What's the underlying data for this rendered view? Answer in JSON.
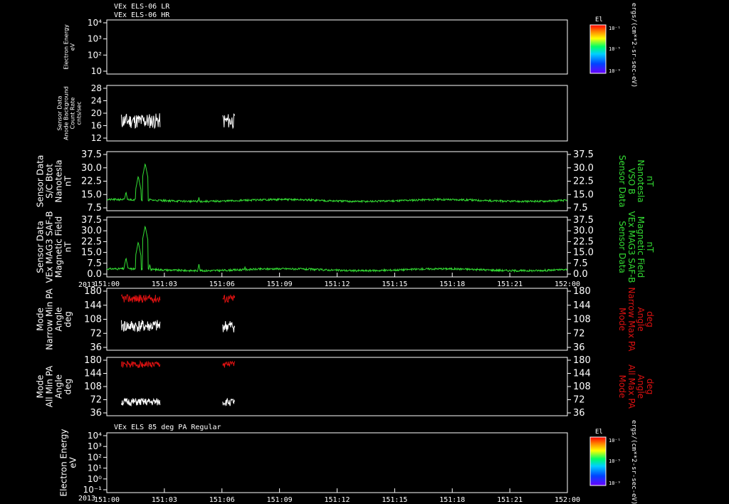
{
  "colors": {
    "background": "#000000",
    "axis": "#ffffff",
    "white_trace": "#ffffff",
    "green_trace": "#33dd33",
    "red_trace": "#dd1111"
  },
  "top_headers": {
    "line1": "VEx ELS-06 LR",
    "line2": "VEx ELS-06 HR"
  },
  "bottom_header": "VEx ELS 85 deg PA Regular",
  "x_axis": {
    "year": "2013",
    "ticks": [
      "151:00",
      "151:03",
      "151:06",
      "151:09",
      "151:12",
      "151:15",
      "151:18",
      "151:21",
      "152:00"
    ]
  },
  "colorbars": [
    {
      "title": "El",
      "ticks": [
        "10⁻¹",
        "10⁻⁵",
        "10⁻⁹"
      ],
      "unit": "ergs/(cm**2-sr-sec-eV)"
    },
    {
      "title": "El",
      "ticks": [
        "10⁻¹",
        "10⁻⁵",
        "10⁻⁹"
      ],
      "unit": "ergs/(cm**2-sr-sec-eV)"
    }
  ],
  "panels": [
    {
      "type": "heatmap",
      "ylabel": [
        "Electron Energy",
        "eV"
      ],
      "yticks": [
        "10⁴",
        "10³",
        "10²",
        "10"
      ]
    },
    {
      "type": "line",
      "ylabel": [
        "Sensor Data",
        "Anode Background",
        "Count Rate",
        "cnts/sec"
      ],
      "yticks": [
        "28",
        "24",
        "20",
        "16",
        "12"
      ]
    },
    {
      "type": "line",
      "ylabel": [
        "Sensor Data",
        "S/C Btot",
        "Nanotesla",
        "nT"
      ],
      "yticks": [
        "37.5",
        "30.0",
        "22.5",
        "15.0",
        "7.5"
      ],
      "right_ylabel": [
        "Sensor Data",
        "VSO B",
        "Nanotesla",
        "nT"
      ],
      "right_yticks": [
        "37.5",
        "30.0",
        "22.5",
        "15.0",
        "7.5"
      ]
    },
    {
      "type": "line",
      "ylabel": [
        "Sensor Data",
        "VEx MAG3 SAF-B",
        "Magnetic Field",
        "nT"
      ],
      "yticks": [
        "37.5",
        "30.0",
        "22.5",
        "15.0",
        "7.5",
        "0.0"
      ],
      "right_ylabel": [
        "Sensor Data",
        "VEx MAG3 SAF-B",
        "Magnetic Field",
        "nT"
      ],
      "right_yticks": [
        "37.5",
        "30.0",
        "22.5",
        "15.0",
        "7.5",
        "0.0"
      ]
    },
    {
      "type": "line",
      "ylabel": [
        "Mode",
        "Narrow Min PA",
        "Angle",
        "deg"
      ],
      "yticks": [
        "180",
        "144",
        "108",
        "72",
        "36"
      ],
      "right_ylabel": [
        "Mode",
        "Narrow Max PA",
        "Angle",
        "deg"
      ],
      "right_yticks": [
        "180",
        "144",
        "108",
        "72",
        "36"
      ]
    },
    {
      "type": "line",
      "ylabel": [
        "Mode",
        "All Min PA",
        "Angle",
        "deg"
      ],
      "yticks": [
        "180",
        "144",
        "108",
        "72",
        "36"
      ],
      "right_ylabel": [
        "Mode",
        "All Max PA",
        "Angle",
        "deg"
      ],
      "right_yticks": [
        "180",
        "144",
        "108",
        "72",
        "36"
      ]
    },
    {
      "type": "heatmap",
      "ylabel": [
        "Electron Energy",
        "eV"
      ],
      "yticks": [
        "10⁴",
        "10³",
        "10²",
        "10¹",
        "10⁰",
        "10⁻¹"
      ]
    }
  ],
  "chart_data": [
    {
      "type": "heatmap",
      "x_minutes_after_151:00": [],
      "data_intervals": [
        [
          151.9,
          153.15
        ],
        [
          153.6,
          156.95
        ],
        [
          165.1,
          166.7
        ]
      ],
      "ylim": [
        1,
        10000
      ],
      "yscale": "log"
    },
    {
      "type": "line",
      "series": [
        {
          "seed": 11,
          "x": [
            [
              151.9,
              156.95
            ],
            [
              165.1,
              166.7
            ]
          ],
          "base": 16.5,
          "amp": 2.5,
          "ylim": [
            10,
            28
          ]
        }
      ]
    },
    {
      "type": "line",
      "series": [
        {
          "seed": 21,
          "xrange": [
            150,
            152
          ],
          "base": 6.5,
          "features": [
            [
              152.5,
              12
            ],
            [
              153.3,
              4
            ],
            [
              154.1,
              22
            ],
            [
              155,
              30
            ],
            [
              155.6,
              8
            ],
            [
              162,
              8.5
            ],
            [
              168,
              7
            ]
          ],
          "ylim": [
            0,
            37.5
          ]
        }
      ]
    },
    {
      "type": "line",
      "series": [
        {
          "seed": 31,
          "xrange": [
            150,
            152
          ],
          "base": 4.5,
          "features": [
            [
              152.5,
              12
            ],
            [
              153.3,
              4
            ],
            [
              154.1,
              22
            ],
            [
              155,
              32
            ],
            [
              155.6,
              8
            ],
            [
              162,
              8
            ],
            [
              168,
              6.5
            ]
          ],
          "ylim": [
            0,
            37.5
          ]
        }
      ]
    },
    {
      "type": "line",
      "series": [
        {
          "name": "min",
          "color_key": "white_trace",
          "seed": 41,
          "x": [
            [
              151.9,
              156.95
            ],
            [
              165.1,
              166.7
            ]
          ],
          "base": 70,
          "amp": 18,
          "ylim": [
            0,
            180
          ]
        },
        {
          "name": "max",
          "color_key": "red_trace",
          "seed": 42,
          "x": [
            [
              151.9,
              156.95
            ],
            [
              165.1,
              166.7
            ]
          ],
          "base": 150,
          "amp": 12,
          "ylim": [
            0,
            180
          ]
        }
      ]
    },
    {
      "type": "line",
      "series": [
        {
          "name": "min",
          "color_key": "white_trace",
          "seed": 51,
          "x": [
            [
              151.9,
              156.95
            ],
            [
              165.1,
              166.7
            ]
          ],
          "base": 42,
          "amp": 12,
          "ylim": [
            0,
            180
          ]
        },
        {
          "name": "max",
          "color_key": "red_trace",
          "seed": 52,
          "x": [
            [
              151.9,
              156.95
            ],
            [
              165.1,
              166.7
            ]
          ],
          "base": 158,
          "amp": 10,
          "ylim": [
            0,
            180
          ]
        }
      ]
    },
    {
      "type": "heatmap",
      "data_intervals": [
        [
          151.9,
          153.15
        ],
        [
          153.6,
          156.95
        ],
        [
          165.1,
          166.6
        ]
      ],
      "ylim": [
        0.1,
        10000
      ],
      "yscale": "log"
    }
  ]
}
